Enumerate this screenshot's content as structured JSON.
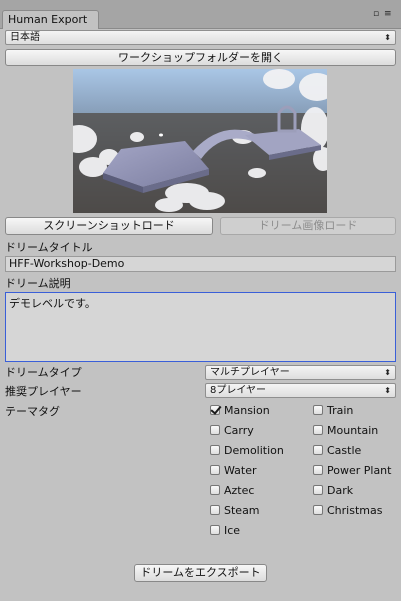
{
  "window": {
    "tab_title": "Human Export",
    "minimize_glyph": "▫",
    "menu_glyph": "≡"
  },
  "language": {
    "selected": "日本語"
  },
  "buttons": {
    "open_workshop_folder": "ワークショップフォルダーを開く",
    "load_screenshot": "スクリーンショットロード",
    "load_dream_image": "ドリーム画像ロード",
    "export_dream": "ドリームをエクスポート"
  },
  "fields": {
    "dream_title_label": "ドリームタイトル",
    "dream_title_value": "HFF-Workshop-Demo",
    "dream_description_label": "ドリーム説明",
    "dream_description_value": "デモレベルです。",
    "dream_type_label": "ドリームタイプ",
    "dream_type_value": "マルチプレイヤー",
    "recommended_players_label": "推奨プレイヤー",
    "recommended_players_value": "8プレイヤー",
    "theme_tags_label": "テーマタグ"
  },
  "tags": [
    {
      "label": "Mansion",
      "checked": true
    },
    {
      "label": "Train",
      "checked": false
    },
    {
      "label": "Carry",
      "checked": false
    },
    {
      "label": "Mountain",
      "checked": false
    },
    {
      "label": "Demolition",
      "checked": false
    },
    {
      "label": "Castle",
      "checked": false
    },
    {
      "label": "Water",
      "checked": false
    },
    {
      "label": "Power Plant",
      "checked": false
    },
    {
      "label": "Aztec",
      "checked": false
    },
    {
      "label": "Dark",
      "checked": false
    },
    {
      "label": "Steam",
      "checked": false
    },
    {
      "label": "Christmas",
      "checked": false
    },
    {
      "label": "Ice",
      "checked": false
    }
  ],
  "icons": {
    "dropdown_arrow": "⬍"
  },
  "colors": {
    "focus_border": "#3a5fd8",
    "panel_bg": "#c2c2c2"
  }
}
